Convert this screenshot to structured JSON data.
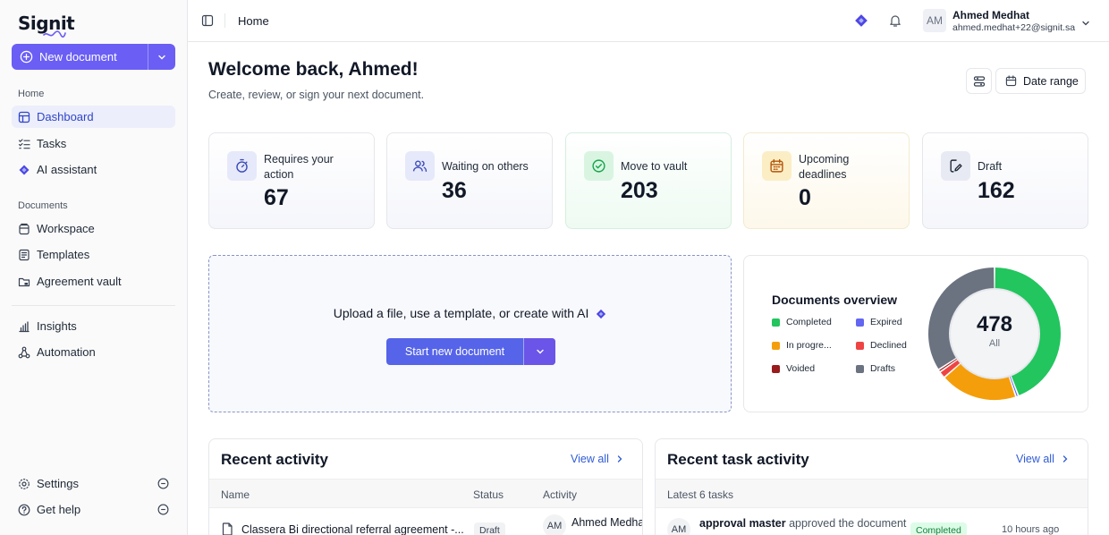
{
  "app": {
    "logo": "Signit"
  },
  "sidebar": {
    "new_document_label": "New document",
    "sections": {
      "home": "Home",
      "documents": "Documents"
    },
    "items": [
      {
        "label": "Dashboard"
      },
      {
        "label": "Tasks"
      },
      {
        "label": "AI assistant"
      },
      {
        "label": "Workspace"
      },
      {
        "label": "Templates"
      },
      {
        "label": "Agreement vault"
      },
      {
        "label": "Insights"
      },
      {
        "label": "Automation"
      },
      {
        "label": "Settings"
      },
      {
        "label": "Get help"
      }
    ]
  },
  "topbar": {
    "breadcrumb": "Home",
    "user": {
      "initials": "AM",
      "name": "Ahmed Medhat",
      "email": "ahmed.medhat+22@signit.sa"
    }
  },
  "main": {
    "welcome": "Welcome back, Ahmed!",
    "subtitle": "Create, review, or sign your next document.",
    "date_range_label": "Date range",
    "stats": [
      {
        "label": "Requires your action",
        "value": "67"
      },
      {
        "label": "Waiting on others",
        "value": "36"
      },
      {
        "label": "Move to vault",
        "value": "203"
      },
      {
        "label": "Upcoming deadlines",
        "value": "0"
      },
      {
        "label": "Draft",
        "value": "162"
      }
    ],
    "upload": {
      "text": "Upload a file, use a template, or create with AI",
      "button_label": "Start new document"
    },
    "overview": {
      "title": "Documents overview",
      "total": "478",
      "total_label": "All",
      "legend": [
        {
          "label": "Completed",
          "color": "#22c55e"
        },
        {
          "label": "Expired",
          "color": "#6366f1"
        },
        {
          "label": "In progre...",
          "color": "#f59e0b"
        },
        {
          "label": "Declined",
          "color": "#ef4444"
        },
        {
          "label": "Voided",
          "color": "#991b1b"
        },
        {
          "label": "Drafts",
          "color": "#6b7280"
        }
      ]
    },
    "recent_activity": {
      "title": "Recent activity",
      "view_all": "View all",
      "columns": [
        "Name",
        "Status",
        "Activity"
      ],
      "rows": [
        {
          "name": "Classera Bi directional referral agreement -...",
          "status": "Draft",
          "initials": "AM",
          "user": "Ahmed Medhat"
        }
      ]
    },
    "recent_tasks": {
      "title": "Recent task activity",
      "view_all": "View all",
      "subheader": "Latest 6 tasks",
      "rows": [
        {
          "initials": "AM",
          "actor": "approval master",
          "action": "approved the document",
          "status": "Completed",
          "time": "10 hours ago"
        }
      ]
    }
  },
  "chart_data": {
    "type": "pie",
    "title": "Documents overview",
    "categories": [
      "Completed",
      "Expired",
      "In progre...",
      "Declined",
      "Voided",
      "Drafts"
    ],
    "values": [
      211,
      3,
      90,
      8,
      3,
      163
    ],
    "total": 478
  }
}
